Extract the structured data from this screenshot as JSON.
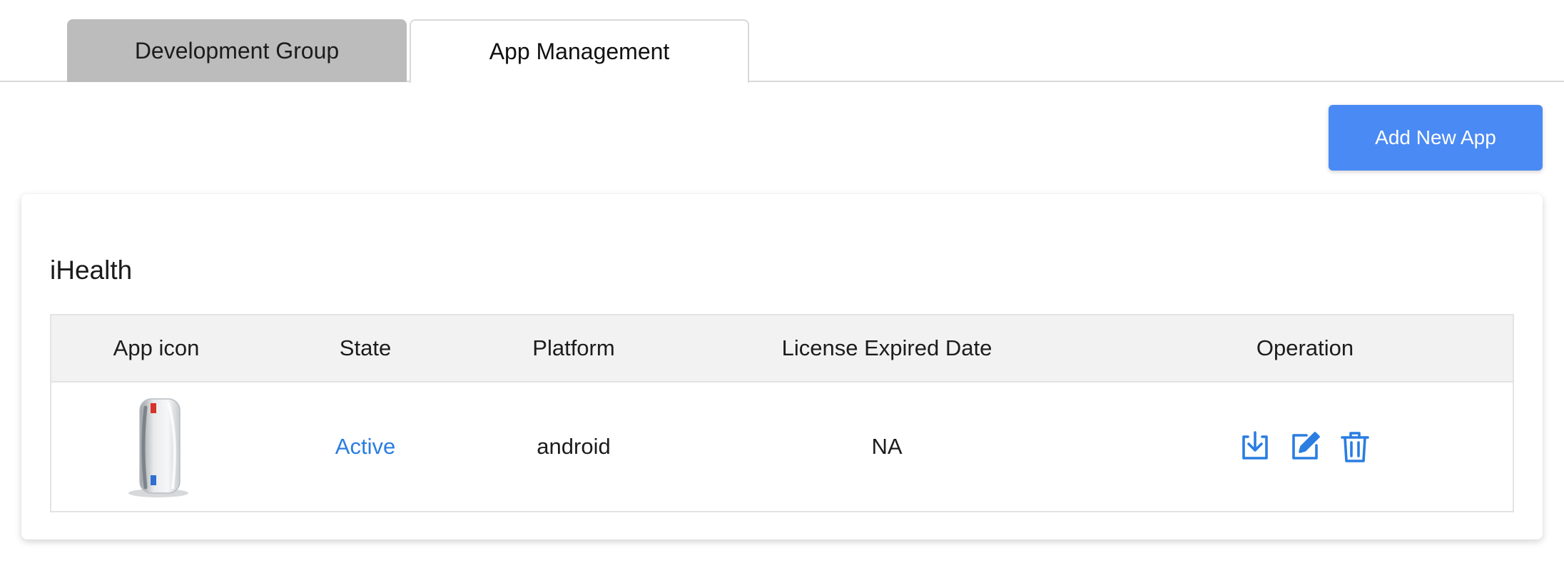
{
  "tabs": [
    {
      "label": "Development Group",
      "active": false
    },
    {
      "label": "App Management",
      "active": true
    }
  ],
  "toolbar": {
    "add_label": "Add New App"
  },
  "group": {
    "title": "iHealth",
    "columns": [
      "App icon",
      "State",
      "Platform",
      "License Expired Date",
      "Operation"
    ],
    "rows": [
      {
        "icon": "device-thumbnail",
        "state": "Active",
        "platform": "android",
        "license_expired_date": "NA",
        "operations": [
          "download-icon",
          "edit-icon",
          "delete-icon"
        ]
      }
    ]
  },
  "colors": {
    "accent": "#4a8af4",
    "link": "#2a7de1",
    "inactive_tab": "#bcbcbc",
    "header_bg": "#f2f2f2"
  }
}
